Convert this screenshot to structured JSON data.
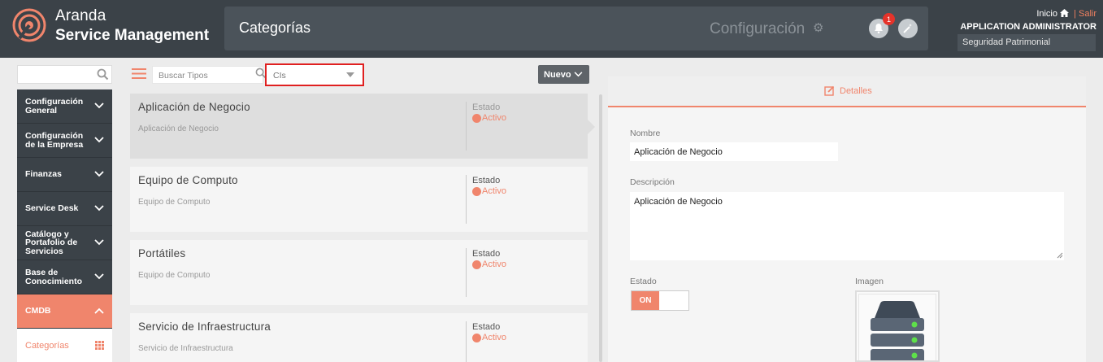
{
  "header": {
    "brand_line1": "Aranda",
    "brand_line2": "Service Management",
    "section_title": "Categorías",
    "config_label": "Configuración",
    "notification_count": "1",
    "inicio_label": "Inicio",
    "salir_label": "Salir",
    "user_name": "APPLICATION ADMINISTRATOR",
    "user_role": "Seguridad Patrimonial"
  },
  "sidebar": {
    "items": [
      {
        "label": "Configuración General"
      },
      {
        "label": "Configuración de la Empresa"
      },
      {
        "label": "Finanzas"
      },
      {
        "label": "Service Desk"
      },
      {
        "label": "Catálogo y Portafolio de Servicios"
      },
      {
        "label": "Base de Conocimiento"
      },
      {
        "label": "CMDB"
      }
    ],
    "sub_item": "Categorías"
  },
  "toolbar": {
    "search_placeholder": "Buscar Tipos",
    "select_value": "CIs",
    "new_button": "Nuevo"
  },
  "list": {
    "status_label": "Estado",
    "items": [
      {
        "title": "Aplicación de Negocio",
        "subtitle": "Aplicación de Negocio",
        "status": "Activo"
      },
      {
        "title": "Equipo de Computo",
        "subtitle": "Equipo de Computo",
        "status": "Activo"
      },
      {
        "title": "Portátiles",
        "subtitle": "Equipo de Computo",
        "status": "Activo"
      },
      {
        "title": "Servicio de Infraestructura",
        "subtitle": "Servicio de Infraestructura",
        "status": "Activo"
      }
    ]
  },
  "details": {
    "tab_label": "Detalles",
    "name_label": "Nombre",
    "name_value": "Aplicación de Negocio",
    "description_label": "Descripción",
    "description_value": "Aplicación de Negocio",
    "state_label": "Estado",
    "toggle_on": "ON",
    "image_label": "Imagen"
  },
  "colors": {
    "accent": "#f0856c",
    "header_bg": "#3b4248",
    "highlight_border": "#e02020"
  }
}
